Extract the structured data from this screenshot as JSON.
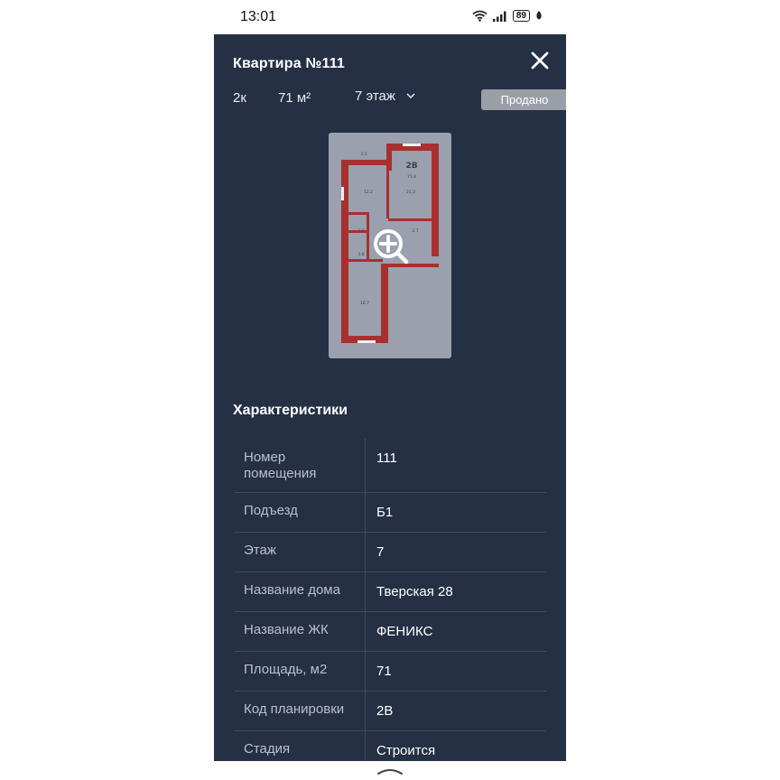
{
  "status_bar": {
    "time": "13:01",
    "battery": "89"
  },
  "header": {
    "title": "Квартира №111",
    "rooms": "2к",
    "area": "71 м²",
    "floor": "7 этаж",
    "status": "Продано"
  },
  "floorplan": {
    "code": "2В",
    "total_area": "71.0",
    "rooms": [
      {
        "label": "3.3"
      },
      {
        "label": "12.2"
      },
      {
        "label": "21.3"
      },
      {
        "label": "1.6"
      },
      {
        "label": "2.7"
      },
      {
        "label": "3.8"
      },
      {
        "label": "16.7"
      }
    ]
  },
  "characteristics": {
    "title": "Характеристики",
    "rows": [
      {
        "key": "Номер помещения",
        "value": "111"
      },
      {
        "key": "Подъезд",
        "value": "Б1"
      },
      {
        "key": "Этаж",
        "value": "7"
      },
      {
        "key": "Название дома",
        "value": "Тверская 28"
      },
      {
        "key": "Название ЖК",
        "value": "ФЕНИКС"
      },
      {
        "key": "Площадь, м2",
        "value": "71"
      },
      {
        "key": "Код планировки",
        "value": "2В"
      },
      {
        "key": "Стадия",
        "value": "Строится"
      }
    ]
  },
  "colors": {
    "panel_bg": "#253045",
    "wall": "#a8302e",
    "plan_bg": "#9aa0ae",
    "badge_bg": "#9a9ea6"
  },
  "icons": {
    "close": "close-icon",
    "chevron": "chevron-down-icon",
    "zoom": "zoom-in-icon",
    "wifi": "wifi-icon",
    "signal": "signal-icon",
    "battery": "battery-icon",
    "nav": "chevron-up-icon"
  }
}
